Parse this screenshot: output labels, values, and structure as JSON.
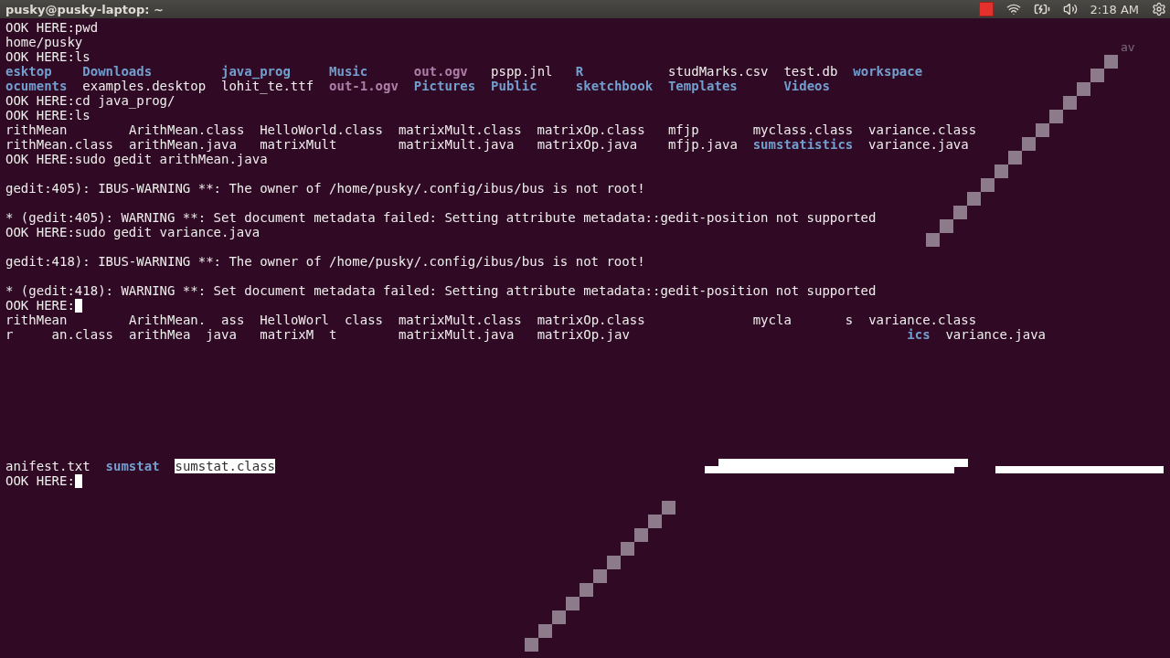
{
  "top_panel": {
    "title": "pusky@pusky-laptop: ~",
    "clock": "2:18 AM"
  },
  "terminal": {
    "lines": [
      {
        "kind": "line",
        "segments": [
          {
            "kind": "text",
            "text": "OOK HERE:pwd"
          }
        ]
      },
      {
        "kind": "line",
        "segments": [
          {
            "kind": "text",
            "text": "home/pusky"
          }
        ]
      },
      {
        "kind": "line",
        "segments": [
          {
            "kind": "text",
            "text": "OOK HERE:ls"
          }
        ]
      },
      {
        "kind": "line",
        "segments": [
          {
            "kind": "dir",
            "text": "esktop    "
          },
          {
            "kind": "dir",
            "text": "Downloads         "
          },
          {
            "kind": "dir",
            "text": "java_prog     "
          },
          {
            "kind": "dir",
            "text": "Music      "
          },
          {
            "kind": "media",
            "text": "out.ogv   "
          },
          {
            "kind": "file",
            "text": "pspp.jnl   "
          },
          {
            "kind": "dir",
            "text": "R           "
          },
          {
            "kind": "file",
            "text": "studMarks.csv  "
          },
          {
            "kind": "file",
            "text": "test.db  "
          },
          {
            "kind": "dir",
            "text": "workspace"
          }
        ]
      },
      {
        "kind": "line",
        "segments": [
          {
            "kind": "dir",
            "text": "ocuments  "
          },
          {
            "kind": "file",
            "text": "examples.desktop  "
          },
          {
            "kind": "file",
            "text": "lohit_te.ttf  "
          },
          {
            "kind": "media",
            "text": "out-1.ogv  "
          },
          {
            "kind": "dir",
            "text": "Pictures  "
          },
          {
            "kind": "dir",
            "text": "Public     "
          },
          {
            "kind": "dir",
            "text": "sketchbook  "
          },
          {
            "kind": "dir",
            "text": "Templates      "
          },
          {
            "kind": "dir",
            "text": "Videos"
          }
        ]
      },
      {
        "kind": "line",
        "segments": [
          {
            "kind": "text",
            "text": "OOK HERE:cd java_prog/"
          }
        ]
      },
      {
        "kind": "line",
        "segments": [
          {
            "kind": "text",
            "text": "OOK HERE:ls"
          }
        ]
      },
      {
        "kind": "line",
        "segments": [
          {
            "kind": "file",
            "text": "rithMean        "
          },
          {
            "kind": "file",
            "text": "ArithMean.class  "
          },
          {
            "kind": "file",
            "text": "HelloWorld.class  "
          },
          {
            "kind": "file",
            "text": "matrixMult.class  "
          },
          {
            "kind": "file",
            "text": "matrixOp.class   "
          },
          {
            "kind": "file",
            "text": "mfjp       "
          },
          {
            "kind": "file",
            "text": "myclass.class  "
          },
          {
            "kind": "file",
            "text": "variance.class"
          }
        ]
      },
      {
        "kind": "line",
        "segments": [
          {
            "kind": "file",
            "text": "rithMean.class  "
          },
          {
            "kind": "file",
            "text": "arithMean.java   "
          },
          {
            "kind": "file",
            "text": "matrixMult        "
          },
          {
            "kind": "file",
            "text": "matrixMult.java   "
          },
          {
            "kind": "file",
            "text": "matrixOp.java    "
          },
          {
            "kind": "file",
            "text": "mfjp.java  "
          },
          {
            "kind": "dir",
            "text": "sumstatistics  "
          },
          {
            "kind": "file",
            "text": "variance.java"
          }
        ]
      },
      {
        "kind": "line",
        "segments": [
          {
            "kind": "text",
            "text": "OOK HERE:sudo gedit arithMean.java"
          }
        ]
      },
      {
        "kind": "blank"
      },
      {
        "kind": "line",
        "segments": [
          {
            "kind": "text",
            "text": "gedit:405): IBUS-WARNING **: The owner of /home/pusky/.config/ibus/bus is not root!"
          }
        ]
      },
      {
        "kind": "blank"
      },
      {
        "kind": "line",
        "segments": [
          {
            "kind": "text",
            "text": "* (gedit:405): WARNING **: Set document metadata failed: Setting attribute metadata::gedit-position not supported"
          }
        ]
      },
      {
        "kind": "line",
        "segments": [
          {
            "kind": "text",
            "text": "OOK HERE:sudo gedit variance.java"
          }
        ]
      },
      {
        "kind": "blank"
      },
      {
        "kind": "line",
        "segments": [
          {
            "kind": "text",
            "text": "gedit:418): IBUS-WARNING **: The owner of /home/pusky/.config/ibus/bus is not root!"
          }
        ]
      },
      {
        "kind": "blank"
      },
      {
        "kind": "line",
        "segments": [
          {
            "kind": "text",
            "text": "* (gedit:418): WARNING **: Set document metadata failed: Setting attribute metadata::gedit-position not supported"
          }
        ]
      },
      {
        "kind": "line",
        "segments": [
          {
            "kind": "text",
            "text": "OOK HERE:"
          },
          {
            "kind": "cursor"
          }
        ]
      },
      {
        "kind": "line",
        "segments": [
          {
            "kind": "file",
            "text": "rithMean        "
          },
          {
            "kind": "file",
            "text": "ArithMean.  "
          },
          {
            "kind": "file",
            "text": "ass  "
          },
          {
            "kind": "file",
            "text": "HelloWorl  "
          },
          {
            "kind": "file",
            "text": "class  "
          },
          {
            "kind": "file",
            "text": "matrixMult.class  "
          },
          {
            "kind": "file",
            "text": "matrixOp.class              "
          },
          {
            "kind": "file",
            "text": "mycla       "
          },
          {
            "kind": "file",
            "text": "s  "
          },
          {
            "kind": "file",
            "text": "variance.class"
          }
        ]
      },
      {
        "kind": "line",
        "segments": [
          {
            "kind": "file",
            "text": "r     "
          },
          {
            "kind": "file",
            "text": "an.class  "
          },
          {
            "kind": "file",
            "text": "arithMea  "
          },
          {
            "kind": "file",
            "text": "java   "
          },
          {
            "kind": "file",
            "text": "matrixM  "
          },
          {
            "kind": "file",
            "text": "t        "
          },
          {
            "kind": "file",
            "text": "matrixMult.java   "
          },
          {
            "kind": "file",
            "text": "matrixOp.jav                                    "
          },
          {
            "kind": "dir",
            "text": "ics  "
          },
          {
            "kind": "file",
            "text": "variance.java"
          }
        ]
      },
      {
        "kind": "blank"
      },
      {
        "kind": "blank"
      },
      {
        "kind": "blank"
      },
      {
        "kind": "blank"
      },
      {
        "kind": "blank"
      },
      {
        "kind": "blank"
      },
      {
        "kind": "blank"
      },
      {
        "kind": "blank"
      },
      {
        "kind": "line",
        "segments": [
          {
            "kind": "file",
            "text": "anifest.txt  "
          },
          {
            "kind": "dir",
            "text": "sumstat  "
          },
          {
            "kind": "selected",
            "text": "sumstat.class"
          }
        ]
      },
      {
        "kind": "line",
        "segments": [
          {
            "kind": "text",
            "text": "OOK HERE:"
          },
          {
            "kind": "cursor"
          }
        ]
      }
    ],
    "artifact_text": "av"
  }
}
